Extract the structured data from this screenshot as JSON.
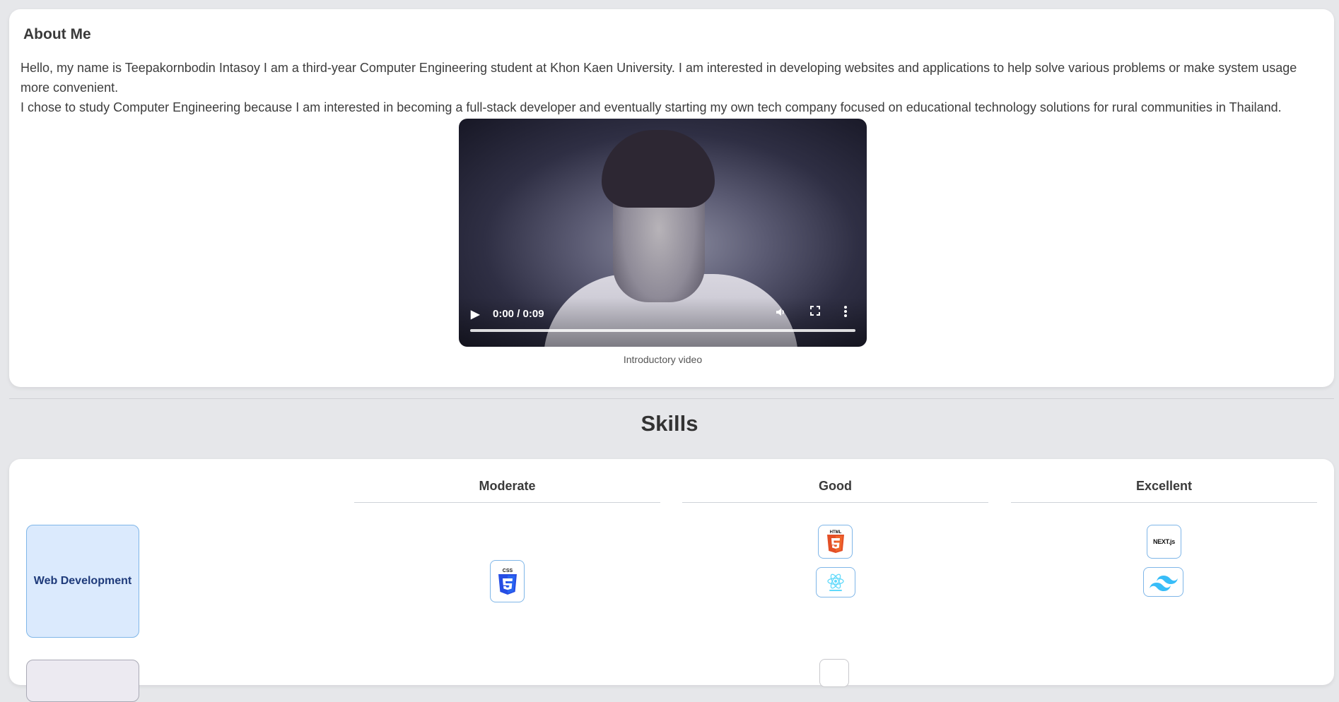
{
  "about": {
    "title": "About Me",
    "paragraph1": "Hello, my name is Teepakornbodin Intasoy I am a third-year Computer Engineering student at Khon Kaen University. I am interested in developing websites and applications to help solve various problems or make system usage more convenient.",
    "paragraph2": "I chose to study Computer Engineering because I am interested in becoming a full-stack developer and eventually starting my own tech company focused on educational technology solutions for rural communities in Thailand.",
    "video": {
      "time_display": "0:00 / 0:09",
      "caption": "Introductory video",
      "play_icon": "play-icon",
      "volume_icon": "volume-icon",
      "fullscreen_icon": "fullscreen-icon",
      "more_icon": "more-options-icon",
      "progress": 0
    }
  },
  "skills": {
    "title": "Skills",
    "columns": [
      "Moderate",
      "Good",
      "Excellent"
    ],
    "categories": [
      {
        "name": "Web Development",
        "moderate": [
          "css3-icon"
        ],
        "good": [
          "html5-icon",
          "react-icon"
        ],
        "excellent": [
          "nextjs-icon",
          "tailwind-icon"
        ]
      }
    ],
    "icon_labels": {
      "css": "CSS",
      "html": "HTML",
      "next": "NEXT.js"
    }
  },
  "colors": {
    "page_bg": "#e6e7ea",
    "card_bg": "#ffffff",
    "category_bg": "#dbeafd",
    "category_border": "#7fb6e8",
    "category_text": "#1e3a7a",
    "css_blue": "#264de4",
    "html_orange": "#e34f26",
    "react_cyan": "#61dafb",
    "tailwind_cyan": "#38bdf8"
  }
}
